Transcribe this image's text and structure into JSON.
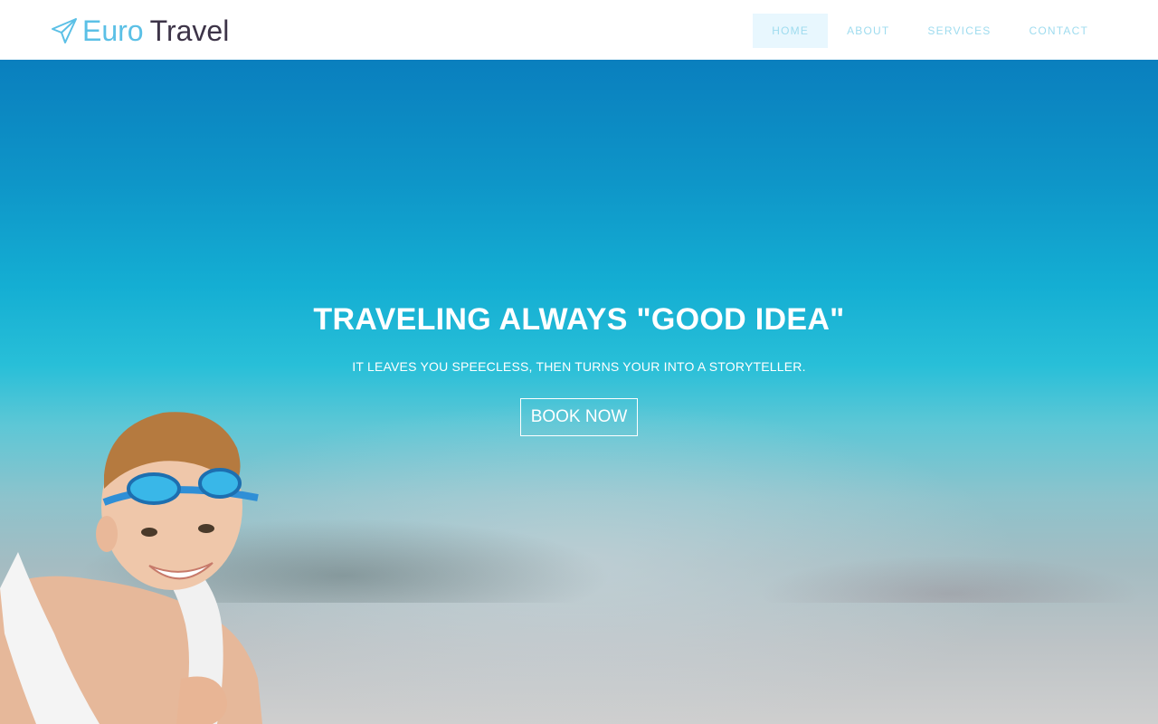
{
  "brand": {
    "word1": "Euro",
    "word2": "Travel",
    "icon": "paper-plane-icon",
    "color_primary": "#5bc0e6",
    "color_secondary": "#3d3448"
  },
  "nav": {
    "items": [
      {
        "label": "HOME",
        "active": true
      },
      {
        "label": "ABOUT",
        "active": false
      },
      {
        "label": "SERVICES",
        "active": false
      },
      {
        "label": "CONTACT",
        "active": false
      }
    ],
    "active_bg": "#e8f7fe",
    "text_color": "#9fdcef"
  },
  "hero": {
    "title_bold": "TRAVELING",
    "title_rest": "ALWAYS \"GOOD IDEA\"",
    "subtitle": "IT LEAVES YOU SPEECLESS, THEN TURNS YOUR INTO A STORYTELLER.",
    "cta_label": "BOOK NOW",
    "image": "beach-background with boy wearing swim goggles and towel"
  }
}
